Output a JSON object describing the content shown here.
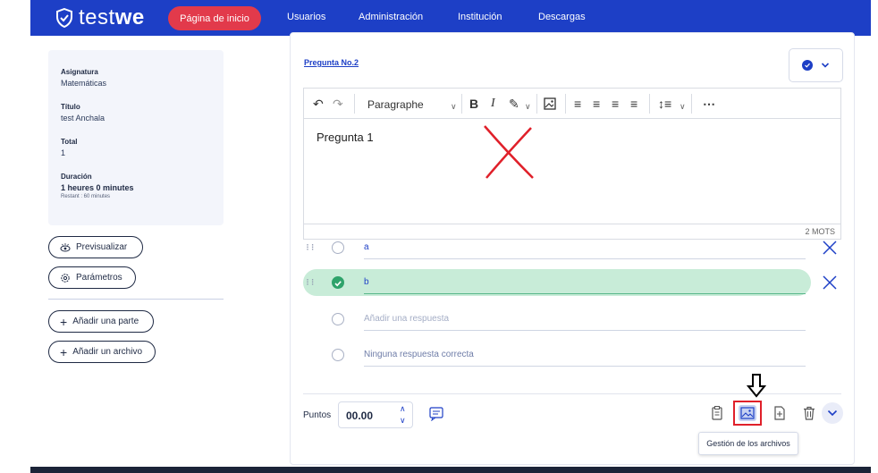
{
  "app": {
    "brand_prefix": "test",
    "brand_suffix": "we"
  },
  "nav": {
    "home": "Página de inicio",
    "items": [
      "Usuarios",
      "Administración",
      "Institución",
      "Descargas"
    ]
  },
  "info": {
    "subject_label": "Asignatura",
    "subject_value": "Matemáticas",
    "title_label": "Título",
    "title_value": "test Anchala",
    "total_label": "Total",
    "total_value": "1",
    "duration_label": "Duración",
    "duration_value": "1 heures 0 minutes",
    "remaining": "Restant : 60 minutes"
  },
  "left_actions": {
    "preview": "Previsualizar",
    "settings": "Parámetros",
    "add_part": "Añadir una parte",
    "add_file": "Añadir un archivo"
  },
  "question": {
    "title": "Pregunta No.2",
    "editor": {
      "paragraph_select": "Paragraphe",
      "content": "Pregunta 1",
      "word_count": "2 MOTS"
    },
    "answers": [
      {
        "text": "a",
        "correct": false
      },
      {
        "text": "b",
        "correct": true
      }
    ],
    "add_answer_placeholder": "Añadir una respuesta",
    "no_correct": "Ninguna respuesta correcta",
    "points_label": "Puntos",
    "points_value": "00.00",
    "tooltip": "Gestión de los archivos"
  },
  "colors": {
    "nav_bg": "#1d3fc6",
    "home_pill": "#e23a4b",
    "correct_bg": "#c8ecd8",
    "correct_check": "#2fa36b",
    "annotation_red": "#e0202a"
  }
}
